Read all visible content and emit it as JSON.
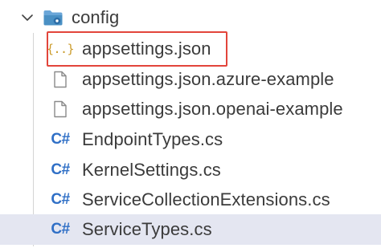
{
  "explorer": {
    "folder": {
      "name": "config",
      "state": "expanded",
      "icon": "folder-config-icon",
      "icon_color": "#4a90c4"
    },
    "files": [
      {
        "name": "appsettings.json",
        "icon": "json-icon",
        "icon_glyph": "{..}",
        "icon_color": "#cb9b2b",
        "highlighted": true,
        "selected": false
      },
      {
        "name": "appsettings.json.azure-example",
        "icon": "file-icon",
        "icon_glyph": "",
        "icon_color": "#8a8a8a",
        "highlighted": false,
        "selected": false
      },
      {
        "name": "appsettings.json.openai-example",
        "icon": "file-icon",
        "icon_glyph": "",
        "icon_color": "#8a8a8a",
        "highlighted": false,
        "selected": false
      },
      {
        "name": "EndpointTypes.cs",
        "icon": "csharp-icon",
        "icon_glyph": "C#",
        "icon_color": "#2f6fc6",
        "highlighted": false,
        "selected": false
      },
      {
        "name": "KernelSettings.cs",
        "icon": "csharp-icon",
        "icon_glyph": "C#",
        "icon_color": "#2f6fc6",
        "highlighted": false,
        "selected": false
      },
      {
        "name": "ServiceCollectionExtensions.cs",
        "icon": "csharp-icon",
        "icon_glyph": "C#",
        "icon_color": "#2f6fc6",
        "highlighted": false,
        "selected": false
      },
      {
        "name": "ServiceTypes.cs",
        "icon": "csharp-icon",
        "icon_glyph": "C#",
        "icon_color": "#2f6fc6",
        "highlighted": false,
        "selected": true
      }
    ],
    "highlight_color": "#e2453b",
    "selected_row_color": "#e4e6f1"
  }
}
